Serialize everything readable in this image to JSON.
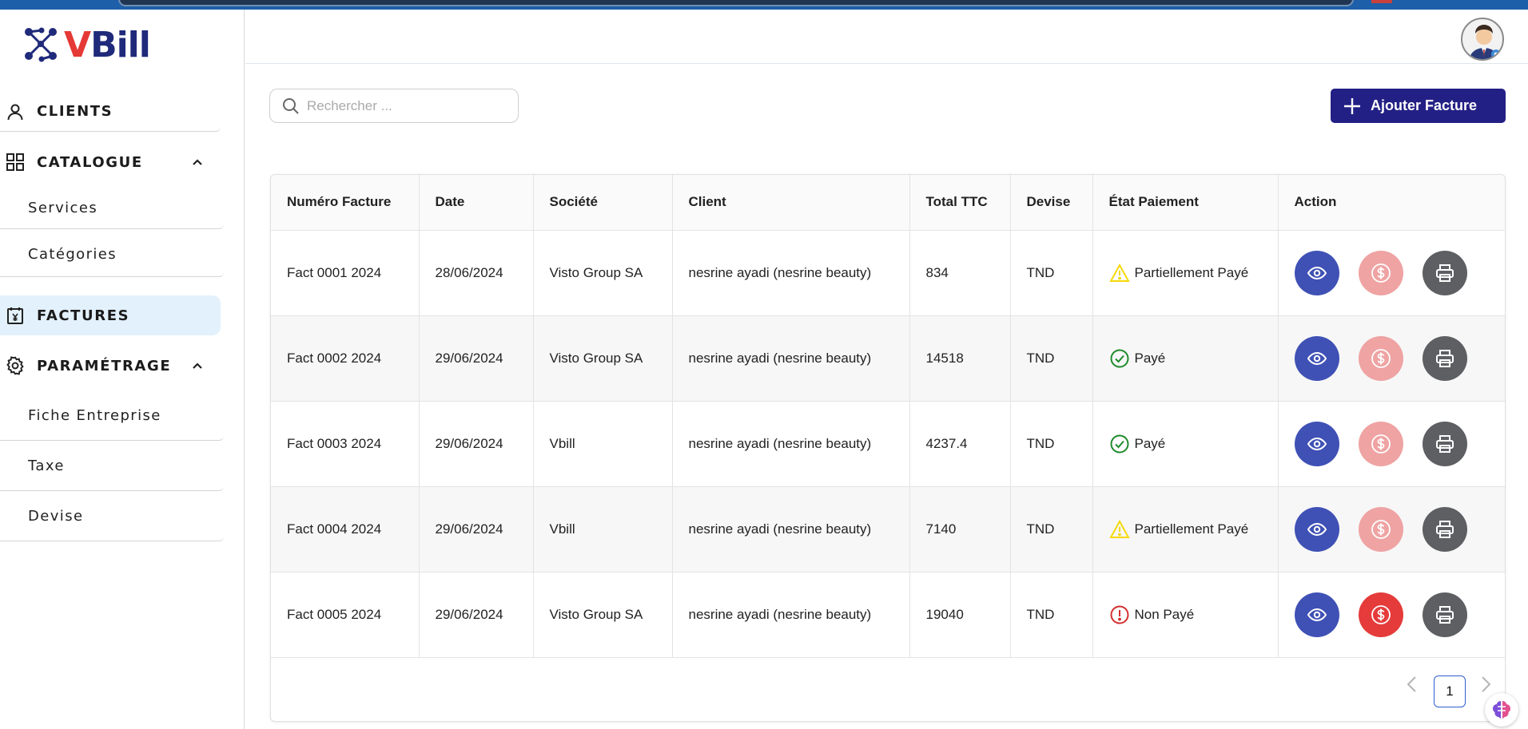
{
  "app": {
    "logo_v": "V",
    "logo_bill": "Bill"
  },
  "sidebar": {
    "clients": "CLIENTS",
    "catalogue": "CATALOGUE",
    "catalogue_items": [
      "Services",
      "Catégories"
    ],
    "factures": "FACTURES",
    "parametrage": "PARAMÉTRAGE",
    "parametrage_items": [
      "Fiche Entreprise",
      "Taxe",
      "Devise"
    ]
  },
  "search": {
    "placeholder": "Rechercher ..."
  },
  "toolbar": {
    "add_label": "Ajouter Facture"
  },
  "table": {
    "headers": [
      "Numéro Facture",
      "Date",
      "Société",
      "Client",
      "Total TTC",
      "Devise",
      "État Paiement",
      "Action"
    ],
    "rows": [
      {
        "numero": "Fact 0001 2024",
        "date": "28/06/2024",
        "societe": "Visto Group SA",
        "client": "nesrine ayadi (nesrine beauty)",
        "total": "834",
        "devise": "TND",
        "etat": "Partiellement Payé",
        "etat_icon": "warning-icon"
      },
      {
        "numero": "Fact 0002 2024",
        "date": "29/06/2024",
        "societe": "Visto Group SA",
        "client": "nesrine ayadi (nesrine beauty)",
        "total": "14518",
        "devise": "TND",
        "etat": "Payé",
        "etat_icon": "check-circle-icon"
      },
      {
        "numero": "Fact 0003 2024",
        "date": "29/06/2024",
        "societe": "Vbill",
        "client": "nesrine ayadi (nesrine beauty)",
        "total": "4237.4",
        "devise": "TND",
        "etat": "Payé",
        "etat_icon": "check-circle-icon"
      },
      {
        "numero": "Fact 0004 2024",
        "date": "29/06/2024",
        "societe": "Vbill",
        "client": "nesrine ayadi (nesrine beauty)",
        "total": "7140",
        "devise": "TND",
        "etat": "Partiellement Payé",
        "etat_icon": "warning-icon"
      },
      {
        "numero": "Fact 0005 2024",
        "date": "29/06/2024",
        "societe": "Visto Group SA",
        "client": "nesrine ayadi (nesrine beauty)",
        "total": "19040",
        "devise": "TND",
        "etat": "Non Payé",
        "etat_icon": "error-circle-icon"
      }
    ]
  },
  "pagination": {
    "current": "1"
  },
  "colors": {
    "brand_navy": "#232085",
    "view_blue": "#3f51b5",
    "pay_faded": "#efa3a3",
    "pay_active": "#e53b3b",
    "print_gray": "#5d5f63",
    "warning_yellow": "#f5d90a",
    "success_green": "#1f8a2c",
    "error_red": "#d32f2f"
  }
}
